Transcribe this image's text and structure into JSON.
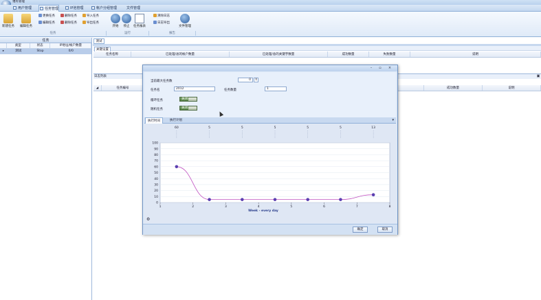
{
  "app": {
    "title": "谁有管理"
  },
  "tabs": [
    {
      "label": "用户管理",
      "active": false
    },
    {
      "label": "任务管理",
      "active": true
    },
    {
      "label": "IP池管理",
      "active": false
    },
    {
      "label": "帐户分组管理",
      "active": false
    },
    {
      "label": "文件管理",
      "active": false
    }
  ],
  "ribbon": {
    "buttons_left": [
      "新建任务",
      "编辑任务"
    ],
    "small_col1": [
      "更换任务",
      "编辑任务"
    ],
    "small_col2": [
      "删除任务",
      "删除任务"
    ],
    "small_col3": [
      "导入任务",
      "导出任务"
    ],
    "buttons_mid": [
      "开始",
      "停止",
      "任务报表"
    ],
    "small_col4": [
      "清除日志",
      "日志导出"
    ],
    "buttons_right": [
      "文件管理"
    ],
    "groups": [
      "任务",
      "运行",
      "报告"
    ]
  },
  "left_panel": {
    "header": "任务",
    "columns": [
      "类型",
      "状态",
      "IP地址/帐户数量"
    ],
    "rows": [
      {
        "name": "测试",
        "status": "Stop",
        "count": "0/0"
      }
    ]
  },
  "main": {
    "tab": "测试",
    "subtab": "关键设置",
    "grid_headers": [
      "任务名称",
      "已处理/总的帐户数量",
      "已处理/总的关键字数量",
      "成功数量",
      "失败数量",
      "说明"
    ],
    "section2_title": "日志列表",
    "grid2_headers": [
      "任务编号",
      "成功数量",
      "说明"
    ]
  },
  "dialog": {
    "title": "",
    "labels": {
      "max_tasks": "当前最大任务数",
      "task_name": "任务名",
      "task_count": "任务数量",
      "loop": "循环任务",
      "delay": "随机任务"
    },
    "values": {
      "max_tasks": "0",
      "task_name": "2012",
      "task_count": "1"
    },
    "toggle_text": "关闭",
    "tabs": [
      "执行时间",
      "执行计划"
    ],
    "buttons": {
      "ok": "确定",
      "cancel": "取消"
    }
  },
  "chart_data": {
    "type": "line",
    "x": [
      1.5,
      2.5,
      3.5,
      4.5,
      5.5,
      6.5,
      7.5
    ],
    "values": [
      60,
      5,
      5,
      5,
      5,
      5,
      13
    ],
    "top_labels": [
      "60",
      "5",
      "5",
      "5",
      "5",
      "5",
      "13"
    ],
    "xlabel": "Week - every day",
    "ylabel": "",
    "xlim": [
      1,
      8
    ],
    "ylim": [
      0,
      100
    ],
    "xticks": [
      "1",
      "2",
      "3",
      "4",
      "5",
      "6",
      "7",
      "8"
    ],
    "yticks": [
      "0",
      "10",
      "20",
      "30",
      "40",
      "50",
      "60",
      "70",
      "80",
      "90",
      "100"
    ],
    "colors": {
      "line": "#c050c0",
      "marker": "#5a3fb0"
    }
  }
}
